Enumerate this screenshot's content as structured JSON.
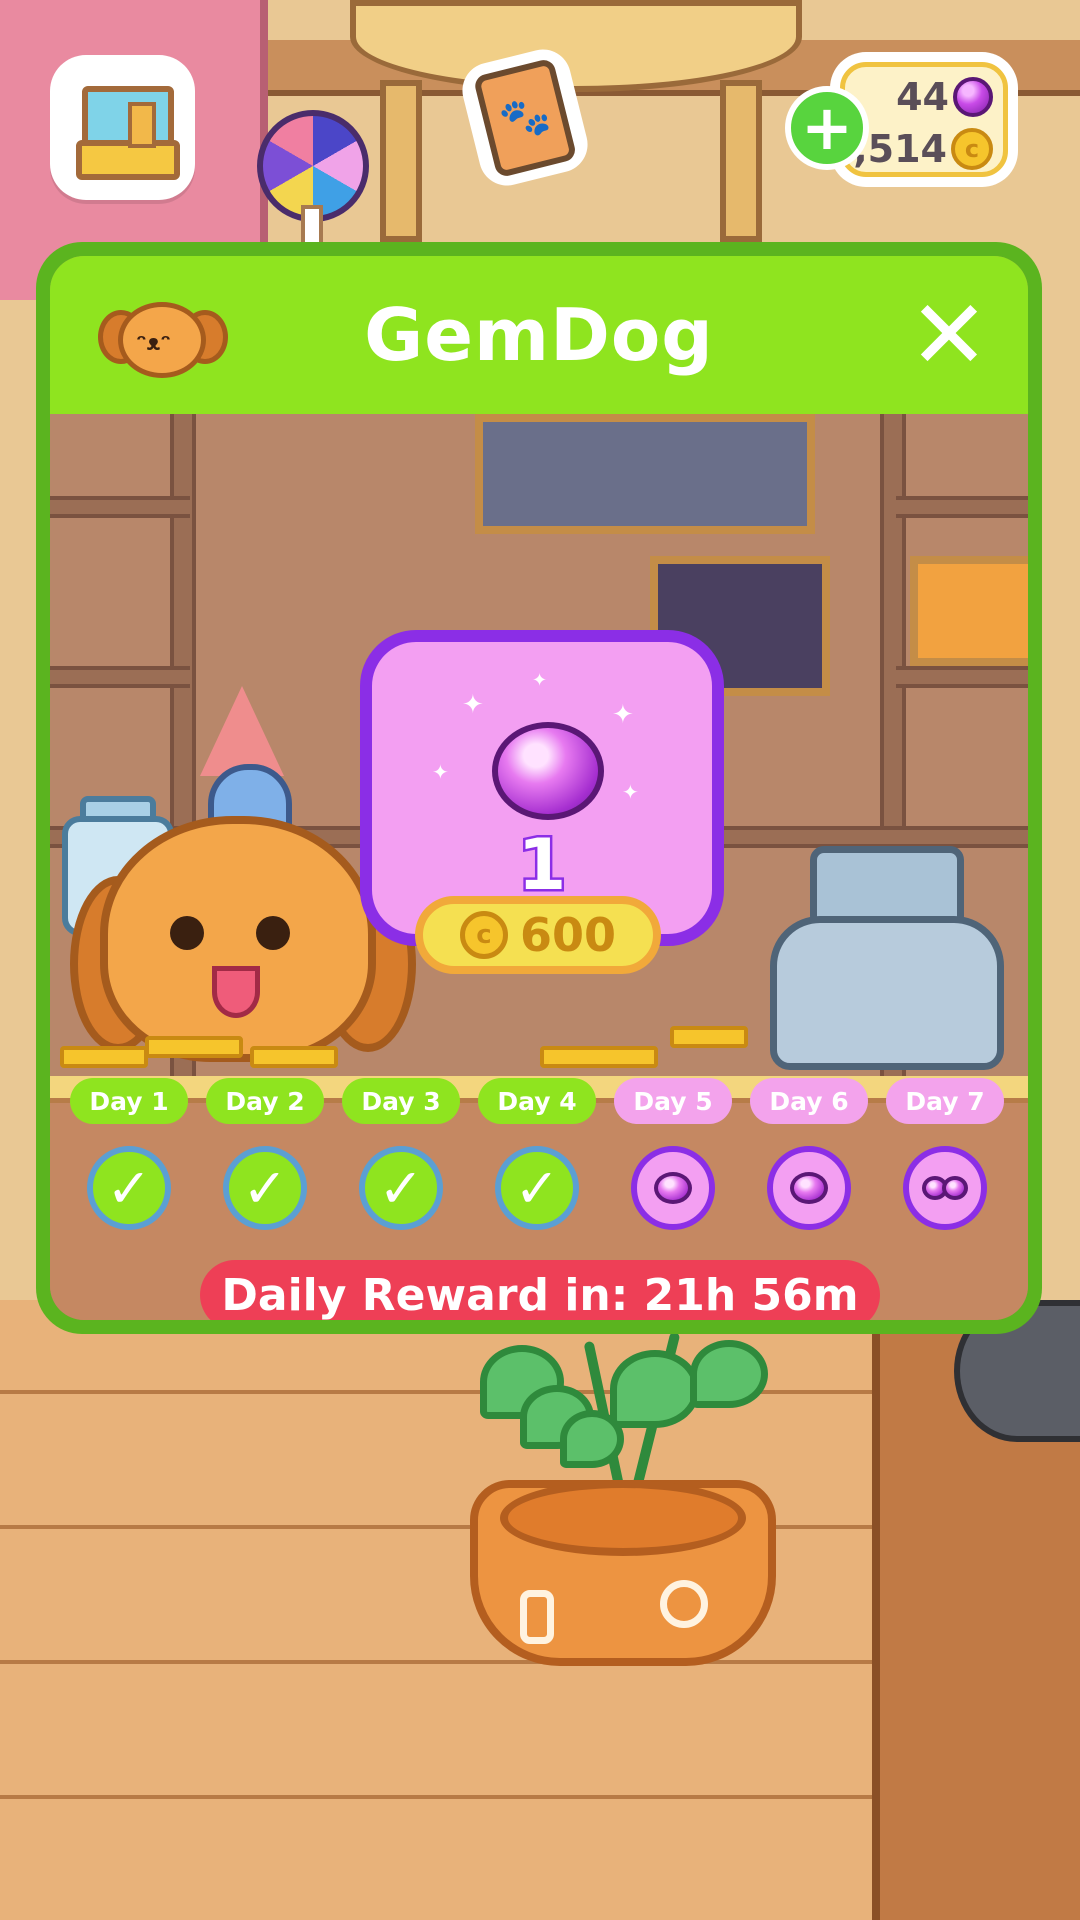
{
  "hud": {
    "gems": "44",
    "coins": "9,514",
    "coin_symbol": "c",
    "plus_label": "+",
    "icons": {
      "room": "room-edit-icon",
      "cards": "paw-card-icon",
      "add": "plus-icon",
      "gem": "gem-icon",
      "coin": "coin-icon"
    }
  },
  "modal": {
    "title": "GemDog",
    "close_label": "✕",
    "reward": {
      "quantity": "1",
      "price": "600",
      "currency_symbol": "c",
      "item_icon": "purple-gem-icon"
    },
    "days": [
      {
        "label": "Day 1",
        "state": "claimed"
      },
      {
        "label": "Day 2",
        "state": "claimed"
      },
      {
        "label": "Day 3",
        "state": "claimed"
      },
      {
        "label": "Day 4",
        "state": "claimed"
      },
      {
        "label": "Day 5",
        "state": "gem"
      },
      {
        "label": "Day 6",
        "state": "gem"
      },
      {
        "label": "Day 7",
        "state": "double-gem"
      }
    ],
    "check_glyph": "✓",
    "timer_text": "Daily Reward in: 21h 56m"
  },
  "colors": {
    "header_green": "#8fe41f",
    "modal_border": "#5bb41f",
    "gem_purple": "#8b2ee6",
    "gem_pink": "#f39ff2",
    "timer_red": "#ee3f56",
    "coin_gold": "#f6c52c"
  }
}
